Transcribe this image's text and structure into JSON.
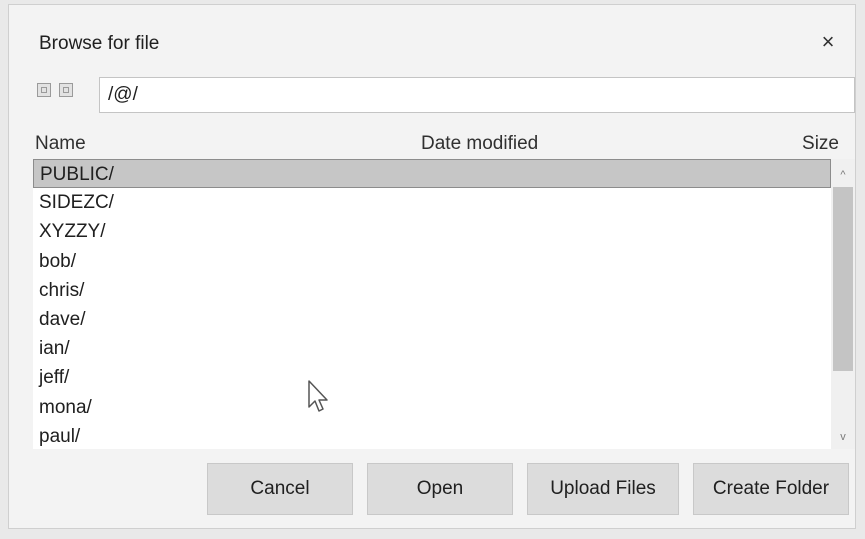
{
  "dialog": {
    "title": "Browse for file",
    "close_glyph": "×",
    "path_value": "/@/"
  },
  "columns": {
    "name": "Name",
    "date": "Date modified",
    "size": "Size"
  },
  "files": [
    "PUBLIC/",
    "SIDEZC/",
    "XYZZY/",
    "bob/",
    "chris/",
    "dave/",
    "ian/",
    "jeff/",
    "mona/",
    "paul/"
  ],
  "selected_index": 0,
  "scrollbar": {
    "up_glyph": "^",
    "down_glyph": "v"
  },
  "buttons": {
    "cancel": "Cancel",
    "open": "Open",
    "upload": "Upload Files",
    "create_folder": "Create Folder"
  },
  "icons": {
    "nav_back": "nav-back-icon",
    "nav_forward": "nav-forward-icon",
    "cursor": "mouse-pointer-icon"
  },
  "colors": {
    "selected_row": "#c6c6c6",
    "button_bg": "#dcdcdc",
    "dialog_bg": "#f3f3f3"
  }
}
